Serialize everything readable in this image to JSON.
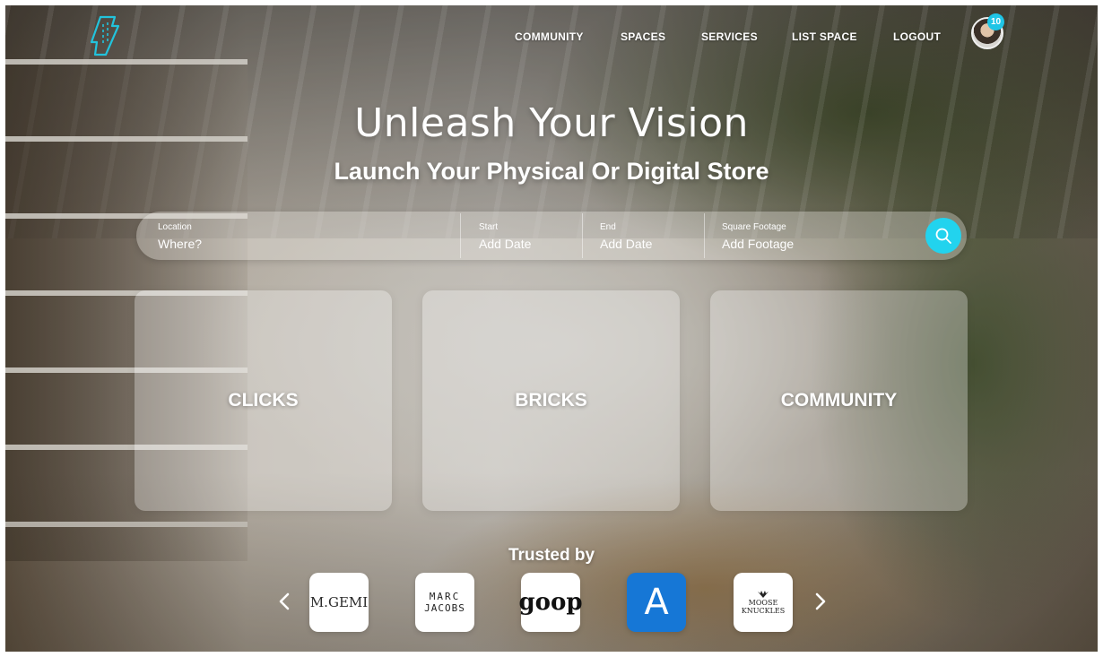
{
  "nav": {
    "items": [
      "COMMUNITY",
      "SPACES",
      "SERVICES",
      "LIST SPACE",
      "LOGOUT"
    ],
    "notification_count": "10"
  },
  "hero": {
    "title": "Unleash Your Vision",
    "subtitle": "Launch Your Physical Or Digital Store"
  },
  "search": {
    "location_label": "Location",
    "location_value": "Where?",
    "start_label": "Start",
    "start_value": "Add Date",
    "end_label": "End",
    "end_value": "Add Date",
    "footage_label": "Square Footage",
    "footage_value": "Add Footage"
  },
  "cards": [
    "CLICKS",
    "BRICKS",
    "COMMUNITY"
  ],
  "trusted": {
    "heading": "Trusted by",
    "brands": [
      {
        "line1": "M.GEMI",
        "line2": ""
      },
      {
        "line1": "MARC",
        "line2": "JACOBS"
      },
      {
        "line1": "goop",
        "line2": ""
      },
      {
        "line1": "A",
        "line2": ""
      },
      {
        "line1": "MOOSE",
        "line2": "KNUCKLES"
      }
    ]
  },
  "colors": {
    "accent": "#22d3ee",
    "badge": "#1fc5e6",
    "brand_blue": "#1677d6",
    "logo": "#22c3dc"
  }
}
